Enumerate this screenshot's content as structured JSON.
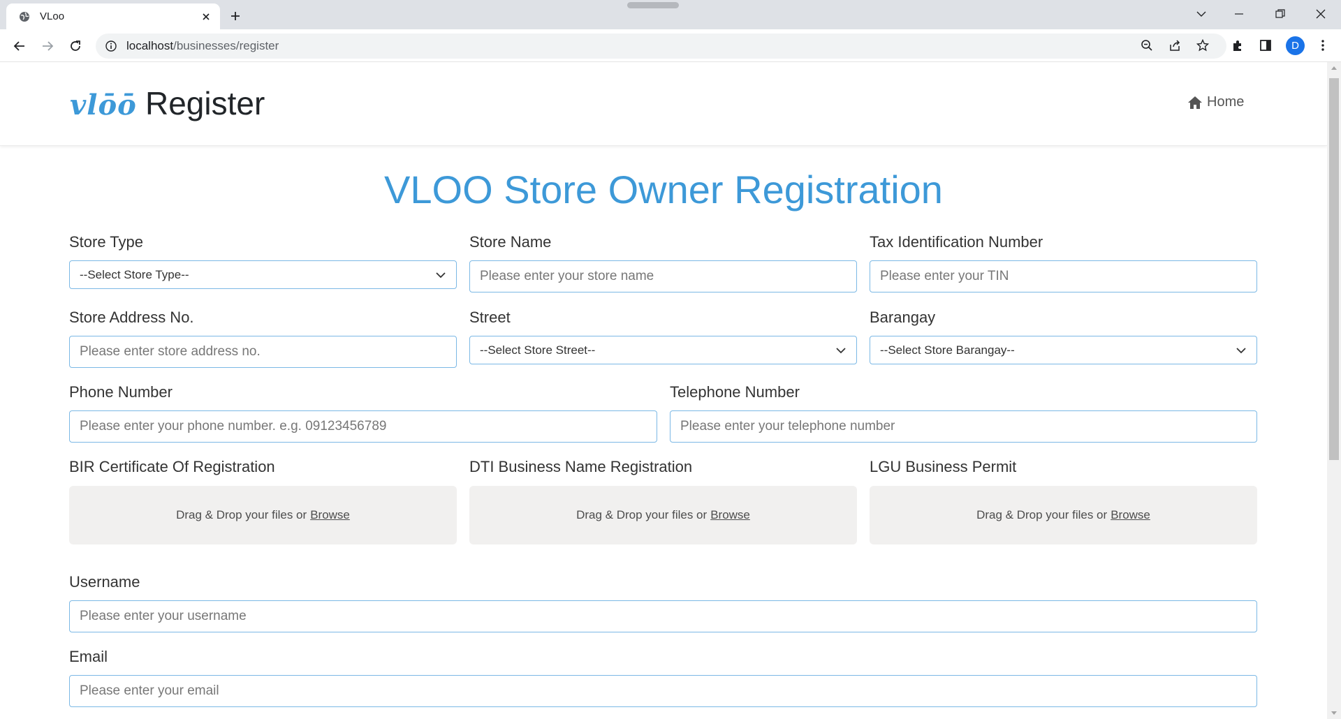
{
  "browser": {
    "tab_title": "VLoo",
    "url_host": "localhost",
    "url_path": "/businesses/register",
    "avatar_letter": "D",
    "icons": [
      "globe-icon",
      "close-icon",
      "plus-icon",
      "back-icon",
      "forward-icon",
      "reload-icon",
      "info-icon",
      "zoom-icon",
      "share-icon",
      "star-icon",
      "extensions-icon",
      "sidepanel-icon",
      "menu-icon",
      "chevron-down-icon",
      "minimize-icon",
      "restore-icon",
      "window-close-icon"
    ]
  },
  "header": {
    "logo_text": "vlōō",
    "title": "Register",
    "home_label": "Home"
  },
  "page": {
    "title": "VLOO Store Owner Registration"
  },
  "form": {
    "store_type": {
      "label": "Store Type",
      "selected": "--Select Store Type--"
    },
    "store_name": {
      "label": "Store Name",
      "placeholder": "Please enter your store name"
    },
    "tin": {
      "label": "Tax Identification Number",
      "placeholder": "Please enter your TIN"
    },
    "address_no": {
      "label": "Store Address No.",
      "placeholder": "Please enter store address no."
    },
    "street": {
      "label": "Street",
      "selected": "--Select Store Street--"
    },
    "barangay": {
      "label": "Barangay",
      "selected": "--Select Store Barangay--"
    },
    "phone": {
      "label": "Phone Number",
      "placeholder": "Please enter your phone number. e.g. 09123456789"
    },
    "telephone": {
      "label": "Telephone Number",
      "placeholder": "Please enter your telephone number"
    },
    "bir": {
      "label": "BIR Certificate Of Registration",
      "drop_text": "Drag & Drop your files or",
      "browse": "Browse"
    },
    "dti": {
      "label": "DTI Business Name Registration",
      "drop_text": "Drag & Drop your files or",
      "browse": "Browse"
    },
    "lgu": {
      "label": "LGU Business Permit",
      "drop_text": "Drag & Drop your files or",
      "browse": "Browse"
    },
    "username": {
      "label": "Username",
      "placeholder": "Please enter your username"
    },
    "email": {
      "label": "Email",
      "placeholder": "Please enter your email"
    }
  },
  "colors": {
    "accent": "#3d99d8",
    "field_border": "#7bb8e5",
    "dropzone_bg": "#f1f0ef"
  }
}
